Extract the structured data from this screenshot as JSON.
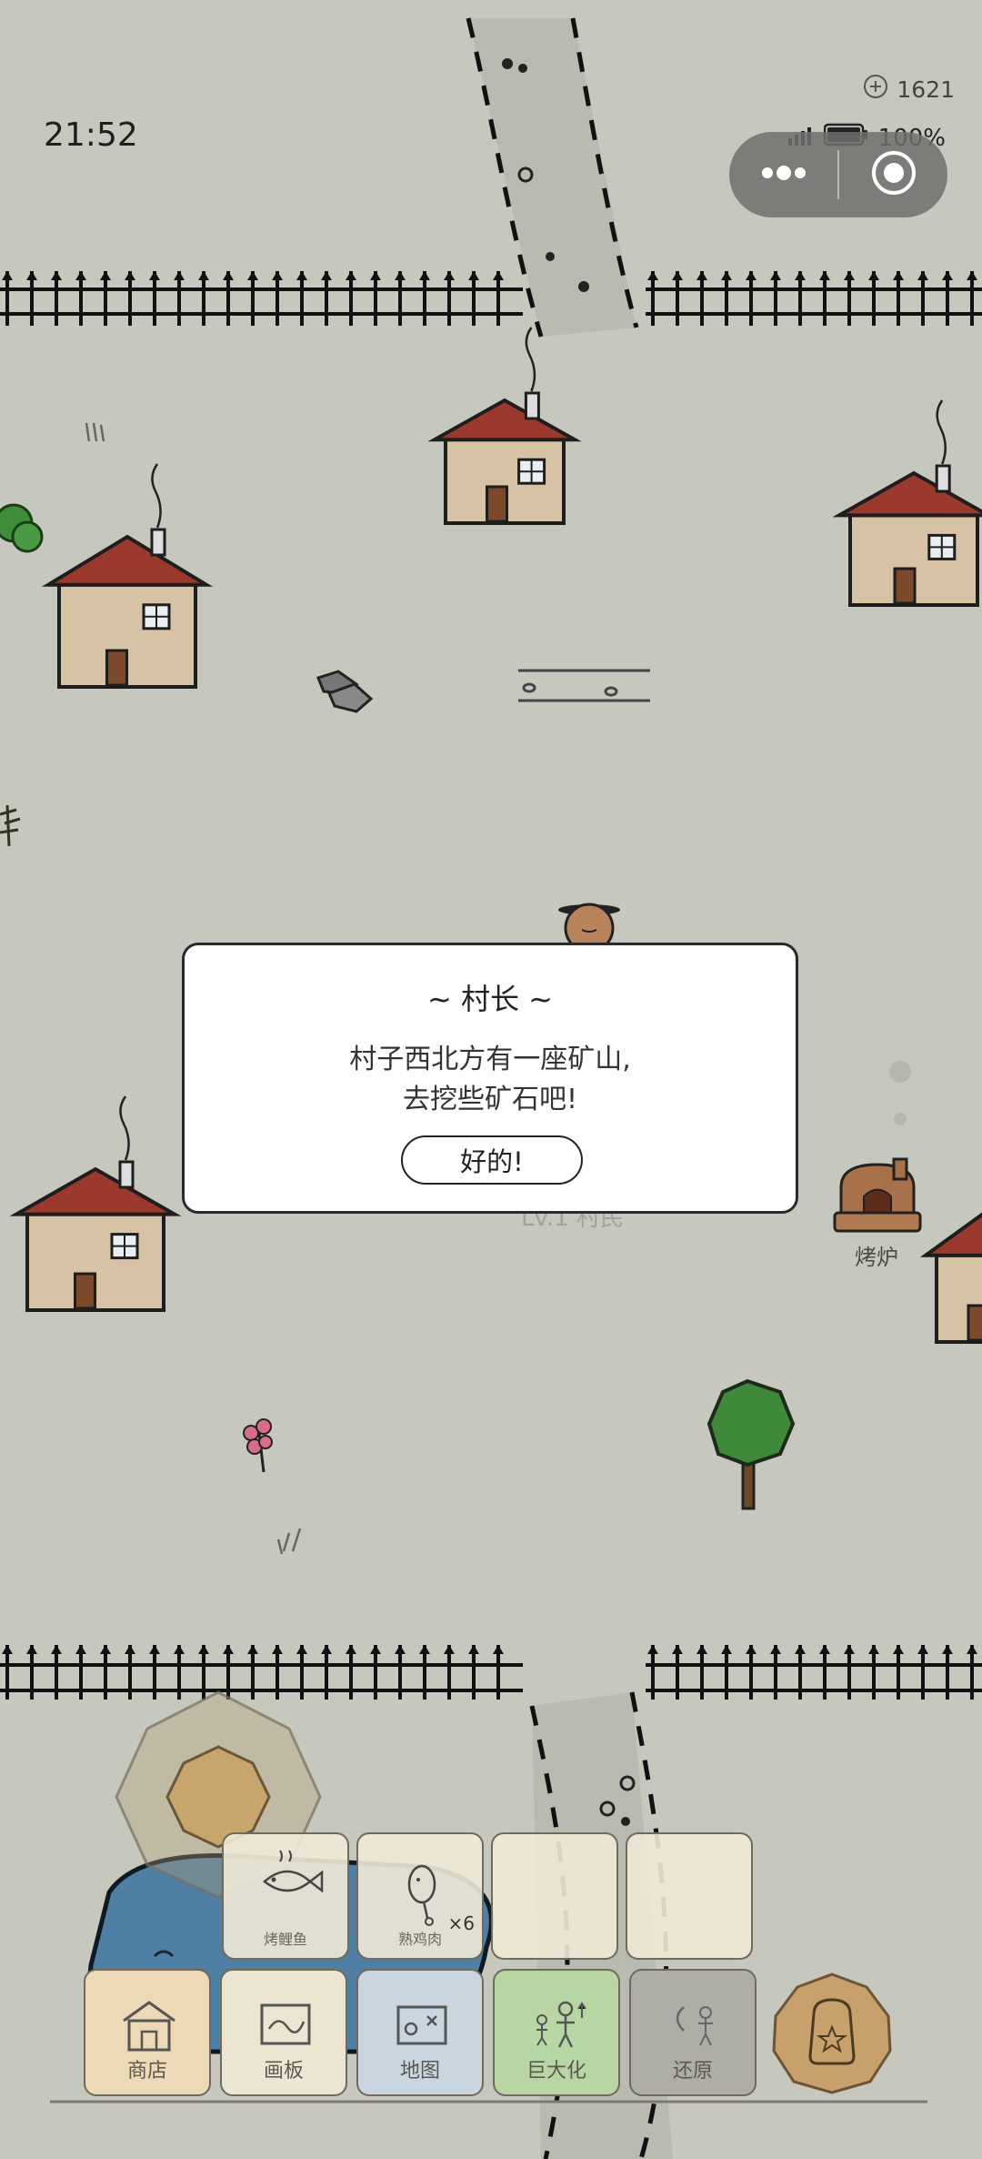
{
  "status_bar": {
    "time": "21:52",
    "battery": "100%"
  },
  "coins": {
    "value": "1621"
  },
  "dialog": {
    "title": "~ 村长 ~",
    "line1": "村子西北方有一座矿山,",
    "line2": "去挖些矿石吧!",
    "ok_label": "好的!"
  },
  "world": {
    "oven_label": "烤炉",
    "npc_hidden_label": "Lv.1 村民"
  },
  "inventory": {
    "items": [
      {
        "label": "烤鲤鱼",
        "icon": "grilled-carp-icon",
        "count": ""
      },
      {
        "label": "熟鸡肉",
        "icon": "cooked-chicken-icon",
        "count": "×6"
      },
      {
        "label": "",
        "icon": "",
        "count": ""
      },
      {
        "label": "",
        "icon": "",
        "count": ""
      }
    ]
  },
  "actions": [
    {
      "label": "商店",
      "icon": "shop-icon"
    },
    {
      "label": "画板",
      "icon": "drawing-board-icon"
    },
    {
      "label": "地图",
      "icon": "map-icon"
    },
    {
      "label": "巨大化",
      "icon": "enlarge-icon"
    },
    {
      "label": "还原",
      "icon": "restore-icon"
    }
  ],
  "colors": {
    "ground": "#c6c8be",
    "roof": "#9b3a2c",
    "wall": "#d6c3a5",
    "shop_slot": "#ecd9b6",
    "map_slot": "#c9d6e0",
    "enlarge_slot": "#b8d6a4",
    "restore_slot": "#aeaea6",
    "backpack": "#c7a06c"
  }
}
